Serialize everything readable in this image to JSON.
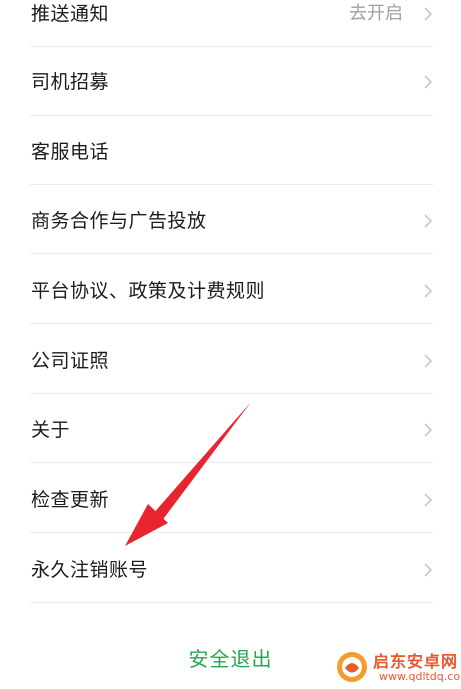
{
  "settings": {
    "items": [
      {
        "label": "推送通知",
        "value": "去开启"
      },
      {
        "label": "司机招募",
        "value": ""
      },
      {
        "label": "客服电话",
        "value": ""
      },
      {
        "label": "商务合作与广告投放",
        "value": ""
      },
      {
        "label": "平台协议、政策及计费规则",
        "value": ""
      },
      {
        "label": "公司证照",
        "value": ""
      },
      {
        "label": "关于",
        "value": ""
      },
      {
        "label": "检查更新",
        "value": ""
      },
      {
        "label": "永久注销账号",
        "value": ""
      }
    ]
  },
  "logout": {
    "label": "安全退出"
  },
  "watermark": {
    "name": "启东安卓网",
    "url": "www.qdltdq.com"
  },
  "colors": {
    "accent": "#23a94f",
    "arrow": "#e8242f",
    "text": "#1c1c1c",
    "muted": "#a0a0a0",
    "divider": "#ececec"
  },
  "icons": {
    "row_chevron": "chevron-right-icon",
    "annotation": "red-arrow-pointer"
  }
}
